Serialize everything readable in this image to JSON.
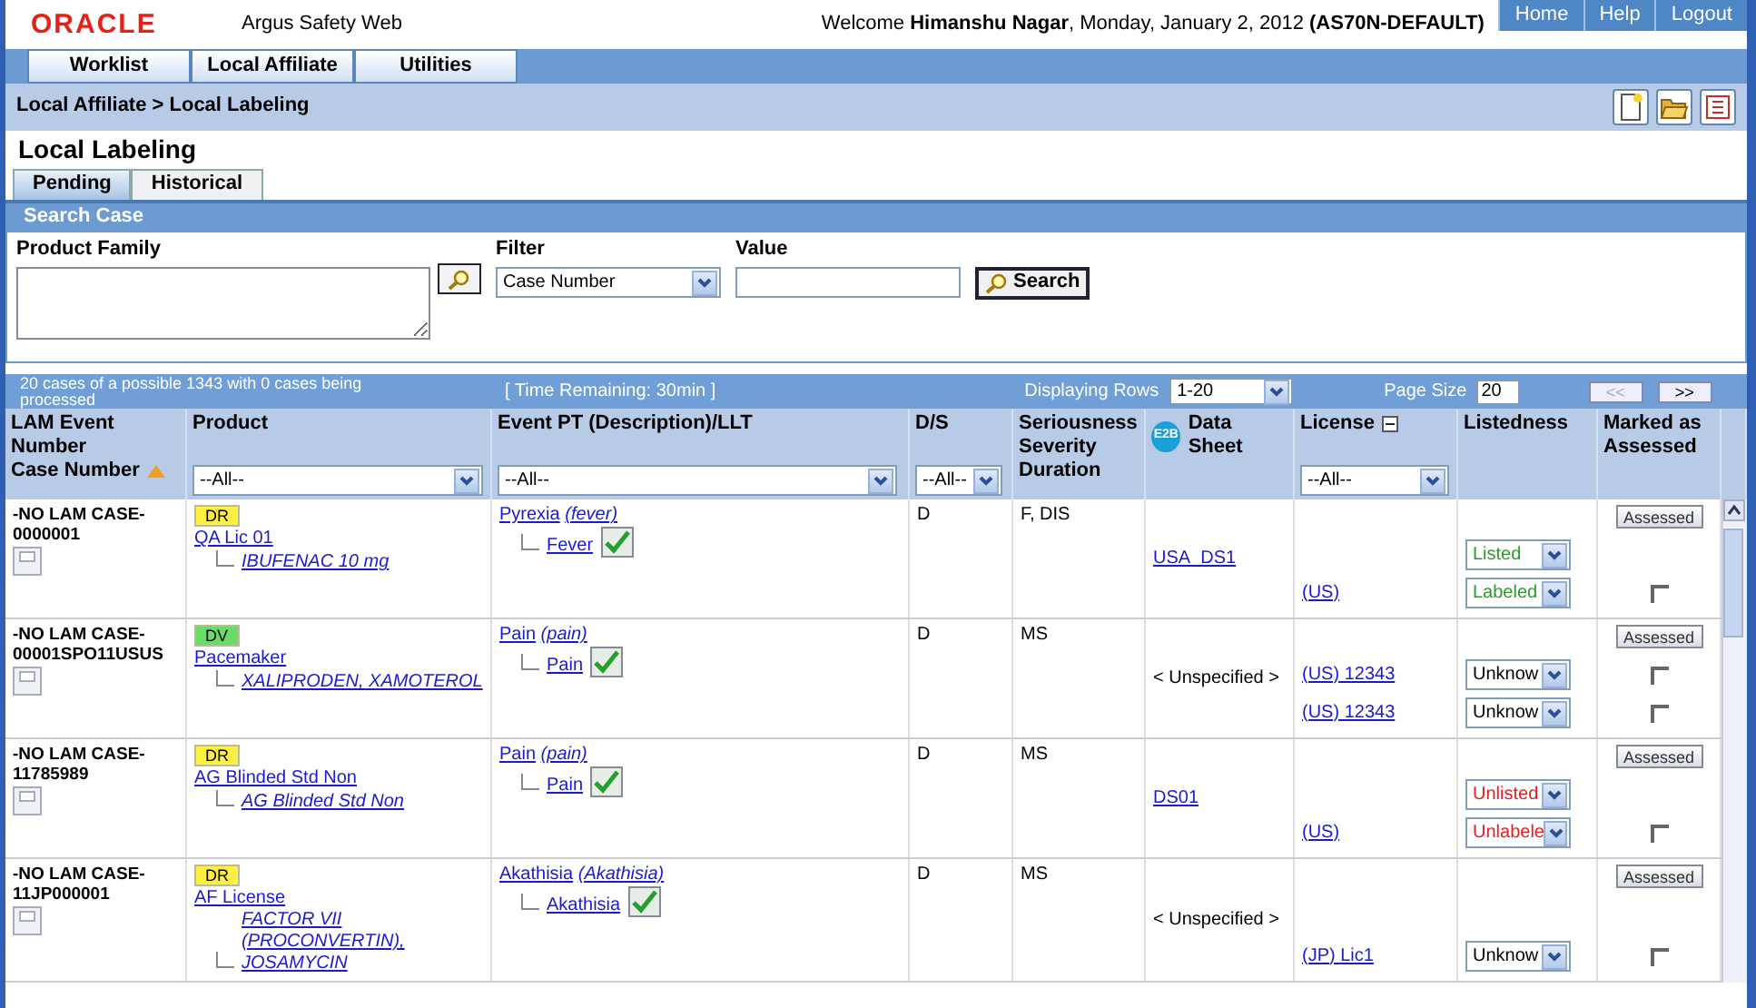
{
  "header": {
    "logo": "ORACLE",
    "app_name": "Argus Safety Web",
    "welcome": "Welcome **Himanshu Nagar**, Monday, January 2, 2012  **(AS70N-DEFAULT)**",
    "links": [
      "Home",
      "Help",
      "Logout"
    ]
  },
  "menu": [
    "Worklist",
    "Local Affiliate",
    "Utilities"
  ],
  "breadcrumb": "Local Affiliate > Local Labeling",
  "page_title": "Local Labeling",
  "tabs": [
    {
      "label": "Pending",
      "selected": true
    },
    {
      "label": "Historical",
      "selected": false
    }
  ],
  "search": {
    "title": "Search Case",
    "product_family_label": "Product Family",
    "filter_label": "Filter",
    "filter_value": "Case Number",
    "value_label": "Value",
    "search_button": "Search"
  },
  "status_bar": {
    "summary": "20 cases of a possible 1343 with 0 cases being processed",
    "time_remaining": "[ Time Remaining: 30min ]",
    "rows_label": "Displaying Rows",
    "rows_value": "1-20",
    "page_size_label": "Page Size",
    "page_size": "20",
    "prev": {
      "label": "<<",
      "disabled": true
    },
    "next": {
      "label": ">>",
      "disabled": false
    }
  },
  "table": {
    "columns": {
      "case_line1": "LAM Event Number",
      "case_line2": "Case Number",
      "product": "Product",
      "event": "Event PT (Description)/LLT",
      "ds": "D/S",
      "seriousness": "Seriousness Severity Duration",
      "e2b_badge": "E2B",
      "data_sheet": "Data Sheet",
      "license": "License",
      "listedness": "Listedness",
      "marked": "Marked as Assessed"
    },
    "filters": {
      "product": "--All--",
      "event": "--All--",
      "ds": "--All--",
      "license": "--All--"
    },
    "rows": [
      {
        "case_number": "-NO LAM CASE-0000001",
        "tag": {
          "text": "DR",
          "color": "#ffee44"
        },
        "product": "QA Lic 01",
        "product_child": "IBUFENAC 10 mg",
        "event_pt": "Pyrexia",
        "event_description": "(fever)",
        "event_llt": "Fever",
        "ds": "D",
        "seriousness": "F, DIS",
        "data_sheet": {
          "text": "USA_DS1",
          "kind": "link"
        },
        "assess_button": "Assessed",
        "lines": [
          {
            "listedness": "Listed",
            "color": "#2a9a2a"
          },
          {
            "license": "(US)",
            "listedness": "Labeled",
            "color": "#2a9a2a",
            "checked": false
          }
        ]
      },
      {
        "case_number": "-NO LAM CASE-00001SPO11USUS",
        "tag": {
          "text": "DV",
          "color": "#66dd66"
        },
        "product": "Pacemaker",
        "product_child": "XALIPRODEN, XAMOTEROL",
        "event_pt": "Pain",
        "event_description": "(pain)",
        "event_llt": "Pain",
        "ds": "D",
        "seriousness": "MS",
        "data_sheet": {
          "text": "< Unspecified >",
          "kind": "text"
        },
        "assess_button": "Assessed",
        "lines": [
          {
            "license": "(US) 12343",
            "listedness": "Unknow",
            "color": "#000000",
            "checked": false
          },
          {
            "license": "(US) 12343",
            "listedness": "Unknow",
            "color": "#000000",
            "checked": false
          }
        ]
      },
      {
        "case_number": "-NO LAM CASE-11785989",
        "tag": {
          "text": "DR",
          "color": "#ffee44"
        },
        "product": "AG Blinded Std Non",
        "product_child": "AG Blinded Std Non",
        "event_pt": "Pain",
        "event_description": "(pain)",
        "event_llt": "Pain",
        "ds": "D",
        "seriousness": "MS",
        "data_sheet": {
          "text": "DS01",
          "kind": "link"
        },
        "assess_button": "Assessed",
        "lines": [
          {
            "listedness": "Unlisted",
            "color": "#e02020"
          },
          {
            "license": "(US)",
            "listedness": "Unlabele",
            "color": "#e02020",
            "checked": false
          }
        ]
      },
      {
        "case_number": "-NO LAM CASE-11JP000001",
        "tag": {
          "text": "DR",
          "color": "#ffee44"
        },
        "product": "AF License",
        "product_child": "FACTOR VII (PROCONVERTIN), JOSAMYCIN",
        "event_pt": "Akathisia",
        "event_description": "(Akathisia)",
        "event_llt": "Akathisia",
        "ds": "D",
        "seriousness": "MS",
        "data_sheet": {
          "text": "< Unspecified >",
          "kind": "text"
        },
        "assess_button": "Assessed",
        "lines": [
          {
            "license": "(JP) Lic1",
            "listedness": "Unknow",
            "color": "#000000",
            "checked": false
          }
        ]
      }
    ]
  }
}
